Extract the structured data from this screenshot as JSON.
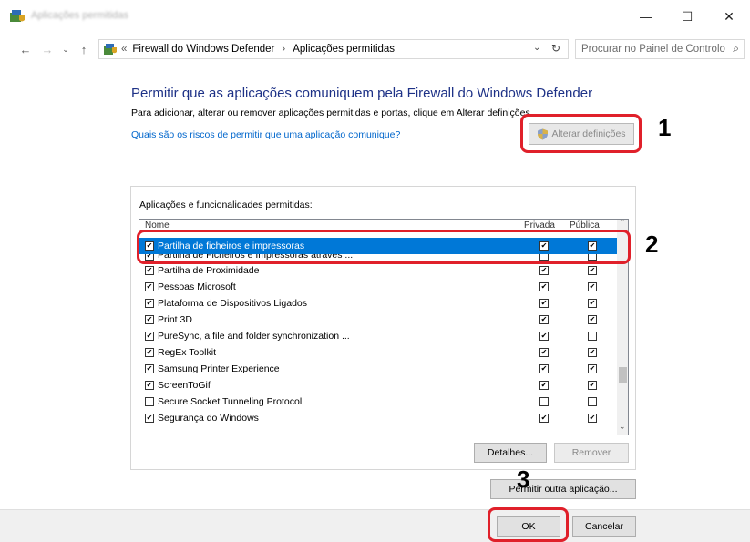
{
  "window": {
    "title": "Aplicações permitidas",
    "buttons": {
      "minimize": "—",
      "maximize": "☐",
      "close": "✕"
    }
  },
  "address": {
    "prefix": "«",
    "crumbs": [
      "Firewall do Windows Defender",
      "Aplicações permitidas"
    ],
    "separator": "›",
    "search_placeholder": "Procurar no Painel de Controlo"
  },
  "content": {
    "heading": "Permitir que as aplicações comuniquem pela Firewall do Windows Defender",
    "description": "Para adicionar, alterar ou remover aplicações permitidas e portas, clique em Alterar definições.",
    "risk_link": "Quais são os riscos de permitir que uma aplicação comunique?",
    "change_settings": "Alterar definições",
    "frame_title": "Aplicações e funcionalidades permitidas:",
    "columns": {
      "name": "Nome",
      "private": "Privada",
      "public": "Pública"
    }
  },
  "apps": [
    {
      "name": "Partilha de ficheiros e impressoras",
      "enabled": true,
      "private": true,
      "public": true,
      "selected": true
    },
    {
      "name": "Partilha de Ficheiros e Impressoras através ...",
      "enabled": true,
      "private": false,
      "public": false,
      "selected": false
    },
    {
      "name": "Partilha de Proximidade",
      "enabled": true,
      "private": true,
      "public": true,
      "selected": false
    },
    {
      "name": "Pessoas Microsoft",
      "enabled": true,
      "private": true,
      "public": true,
      "selected": false
    },
    {
      "name": "Plataforma de Dispositivos Ligados",
      "enabled": true,
      "private": true,
      "public": true,
      "selected": false
    },
    {
      "name": "Print 3D",
      "enabled": true,
      "private": true,
      "public": true,
      "selected": false
    },
    {
      "name": "PureSync, a file and folder synchronization ...",
      "enabled": true,
      "private": true,
      "public": false,
      "selected": false
    },
    {
      "name": "RegEx Toolkit",
      "enabled": true,
      "private": true,
      "public": true,
      "selected": false
    },
    {
      "name": "Samsung Printer Experience",
      "enabled": true,
      "private": true,
      "public": true,
      "selected": false
    },
    {
      "name": "ScreenToGif",
      "enabled": true,
      "private": true,
      "public": true,
      "selected": false
    },
    {
      "name": "Secure Socket Tunneling Protocol",
      "enabled": false,
      "private": false,
      "public": false,
      "selected": false
    },
    {
      "name": "Segurança do Windows",
      "enabled": true,
      "private": true,
      "public": true,
      "selected": false
    }
  ],
  "buttons": {
    "details": "Detalhes...",
    "remove": "Remover",
    "allow_other": "Permitir outra aplicação...",
    "ok": "OK",
    "cancel": "Cancelar"
  },
  "steps": {
    "one": "1",
    "two": "2",
    "three": "3"
  },
  "colors": {
    "accent": "#0078d7",
    "heading": "#1e3287",
    "link": "#0066cc",
    "callout": "#e0202a"
  }
}
